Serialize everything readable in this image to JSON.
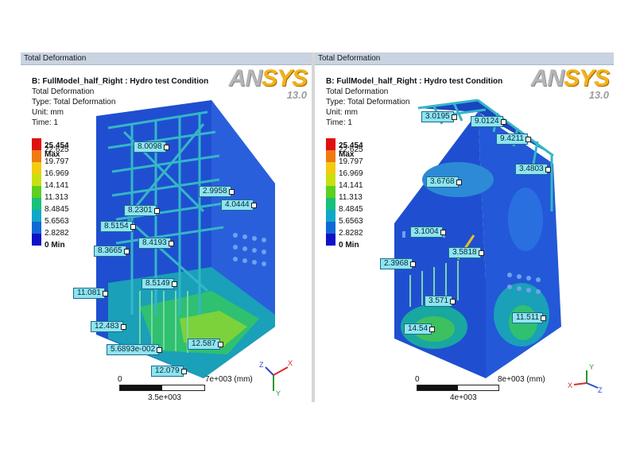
{
  "left": {
    "tab_title": "Total Deformation",
    "info": {
      "line1": "B: FullModel_half_Right : Hydro test Condition",
      "line2": "Total Deformation",
      "line3": "Type: Total Deformation",
      "line4": "Unit: mm",
      "line5": "Time: 1"
    },
    "logo": {
      "brand_a": "AN",
      "brand_b": "SYS",
      "version": "13.0"
    },
    "legend": {
      "max_label": "25.454 Max",
      "levels": [
        "22.625",
        "19.797",
        "16.969",
        "14.141",
        "11.313",
        "8.4845",
        "5.6563",
        "2.8282"
      ],
      "min_label": "0 Min",
      "colors": [
        "#e01010",
        "#f07a10",
        "#f2cc10",
        "#c8e010",
        "#5cd020",
        "#18c07a",
        "#10a8c8",
        "#1068d8",
        "#1010c8"
      ]
    },
    "probes": [
      "8.0098",
      "2.9958",
      "4.0444",
      "8.2301",
      "8.5154",
      "8.4193",
      "8.3665",
      "8.5149",
      "11.081",
      "12.483",
      "5.6893e-002",
      "12.587",
      "12.079"
    ],
    "scale": {
      "zero": "0",
      "end": "7e+003 (mm)",
      "mid": "3.5e+003"
    },
    "triad": {
      "z": "Z",
      "x": "X",
      "y": "Y"
    }
  },
  "right": {
    "tab_title": "Total Deformation",
    "info": {
      "line1": "B: FullModel_half_Right : Hydro test Condition",
      "line2": "Total Deformation",
      "line3": "Type: Total Deformation",
      "line4": "Unit: mm",
      "line5": "Time: 1"
    },
    "logo": {
      "brand_a": "AN",
      "brand_b": "SYS",
      "version": "13.0"
    },
    "legend": {
      "max_label": "25.454 Max",
      "levels": [
        "22.625",
        "19.797",
        "16.969",
        "14.141",
        "11.313",
        "8.4845",
        "5.6563",
        "2.8282"
      ],
      "min_label": "0 Min"
    },
    "probes": [
      "3.0195",
      "9.0124",
      "9.4211",
      "3.4803",
      "3.6768",
      "3.1004",
      "3.5818",
      "2.3968",
      "3.571",
      "14.54",
      "11.511"
    ],
    "scale": {
      "zero": "0",
      "end": "8e+003 (mm)",
      "mid": "4e+003"
    },
    "triad": {
      "x": "X",
      "z": "Z",
      "y": "Y"
    }
  }
}
